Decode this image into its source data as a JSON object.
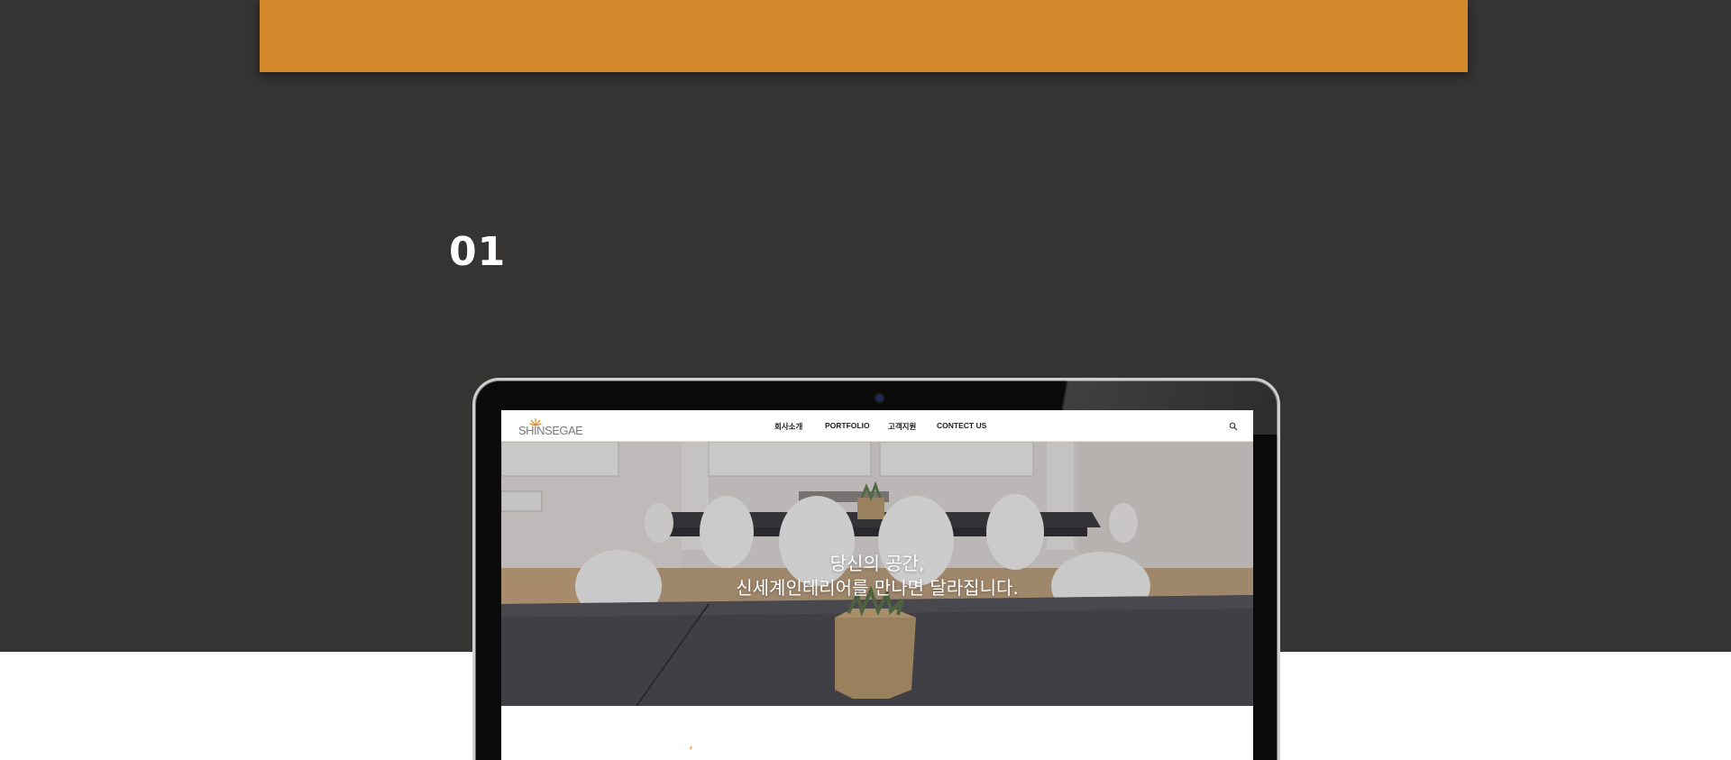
{
  "colors": {
    "accent": "#d48a2c",
    "dark_background": "#353432"
  },
  "section": {
    "step_number": "01"
  },
  "laptop_site": {
    "logo_text": "SHINSEGAE",
    "nav": [
      {
        "label": "회사소개"
      },
      {
        "label": "PORTFOLIO"
      },
      {
        "label": "고객지원"
      },
      {
        "label": "CONTECT US"
      }
    ],
    "search_icon": "search-icon",
    "hero": {
      "line1": "당신의 공간,",
      "line2": "신세계인테리어를 만나면 달라집니다."
    },
    "quote_mark": "‘"
  }
}
